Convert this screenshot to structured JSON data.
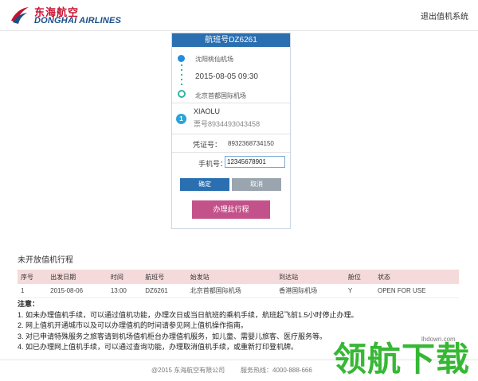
{
  "brand": {
    "name_cn": "东海航空",
    "name_en": "DONGHAI AIRLINES",
    "colors": {
      "red": "#c8102e",
      "blue": "#1a4e8a"
    }
  },
  "header": {
    "logout": "退出值机系统"
  },
  "flight_card": {
    "title": "航班号DZ6261",
    "route": {
      "from": "沈阳桃仙机场",
      "datetime": "2015-08-05 09:30",
      "to": "北京首都国际机场"
    },
    "passenger": {
      "index": "1",
      "name": "XIAOLU",
      "ticket": "票号8934493043458"
    },
    "voucher": {
      "label": "凭证号：",
      "value": "8932368734150"
    },
    "phone": {
      "label": "手机号：",
      "value": "12345678901"
    },
    "buttons": {
      "confirm": "确定",
      "cancel": "取消",
      "process": "办理此行程"
    }
  },
  "unopened": {
    "title": "未开放值机行程",
    "columns": [
      "序号",
      "出发日期",
      "时间",
      "航班号",
      "始发站",
      "到达站",
      "舱位",
      "状态"
    ],
    "rows": [
      [
        "1",
        "2015-08-06",
        "13:00",
        "DZ6261",
        "北京首都国际机场",
        "香港国际机场",
        "Y",
        "OPEN FOR USE"
      ]
    ]
  },
  "notes": {
    "title": "注意：",
    "items": [
      "1. 如未办理值机手续，可以通过值机功能，办理次日或当日航班的乘机手续，航班起飞前1.5小时停止办理。",
      "2. 网上值机开通城市以及可以办理值机的时间请参见网上值机操作指南。",
      "3. 对已申请特殊服务之旅客请到机场值机柜台办理值机服务，如儿童、需婴儿旅客、医疗服务等。",
      "4. 如已办理网上值机手续，可以通过查询功能，办理取消值机手续，或重新打印登机牌。"
    ]
  },
  "footer": {
    "copyright": "@2015 东海航空有限公司",
    "hotline": "服务热线：4000-888-666"
  },
  "watermark": {
    "text": "领航下载",
    "url": "lhdown.com"
  }
}
